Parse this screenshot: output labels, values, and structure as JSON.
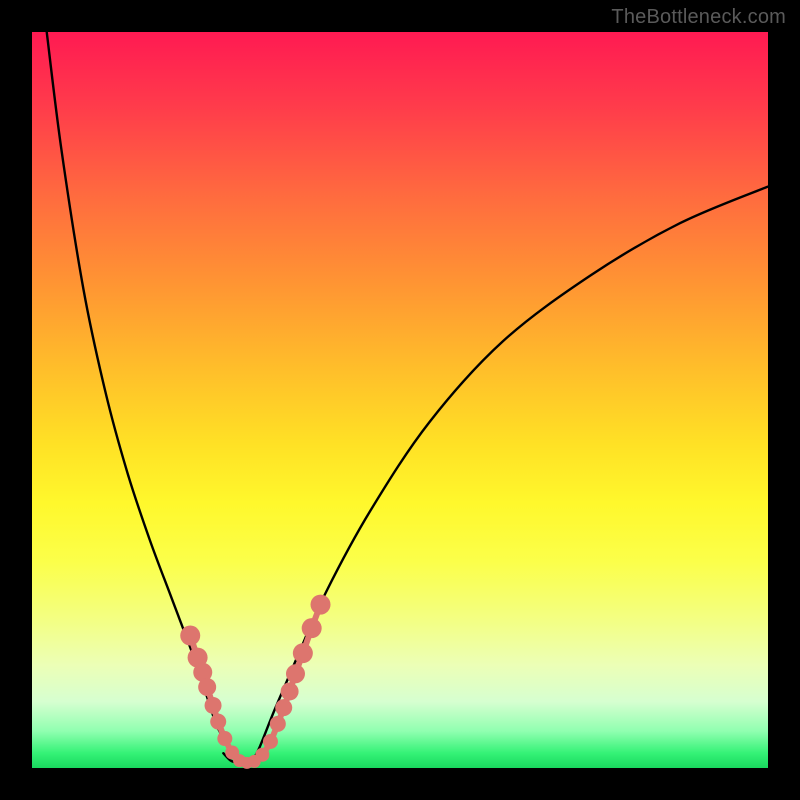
{
  "attribution": "TheBottleneck.com",
  "colors": {
    "bead": "#dd756e",
    "curve": "#000000",
    "background_frame": "#000000"
  },
  "chart_data": {
    "type": "line",
    "title": "",
    "xlabel": "",
    "ylabel": "",
    "xlim": [
      0,
      100
    ],
    "ylim": [
      0,
      100
    ],
    "grid": false,
    "legend": false,
    "annotations": [
      "TheBottleneck.com"
    ],
    "series": [
      {
        "name": "left-curve",
        "x": [
          2,
          4,
          7,
          10,
          13,
          16,
          19,
          22,
          24,
          25,
          26,
          27,
          28
        ],
        "y": [
          100,
          84,
          65,
          51,
          40,
          31,
          23,
          15,
          9,
          6,
          4,
          2,
          1
        ]
      },
      {
        "name": "right-curve",
        "x": [
          30,
          31,
          33,
          36,
          40,
          46,
          54,
          64,
          76,
          88,
          100
        ],
        "y": [
          1,
          3,
          8,
          15,
          24,
          35,
          47,
          58,
          67,
          74,
          79
        ]
      },
      {
        "name": "valley-floor",
        "x": [
          26,
          27,
          28,
          29,
          30,
          31,
          32
        ],
        "y": [
          2,
          1,
          0.7,
          0.6,
          0.7,
          1,
          2
        ]
      }
    ],
    "markers": {
      "name": "beads",
      "note": "salmon dotted overlay near valley on both branches",
      "points": [
        {
          "x": 21.5,
          "y": 18
        },
        {
          "x": 22.5,
          "y": 15
        },
        {
          "x": 23.2,
          "y": 13
        },
        {
          "x": 23.8,
          "y": 11
        },
        {
          "x": 24.6,
          "y": 8.5
        },
        {
          "x": 25.3,
          "y": 6.3
        },
        {
          "x": 26.2,
          "y": 4
        },
        {
          "x": 27.2,
          "y": 2.1
        },
        {
          "x": 28.2,
          "y": 1
        },
        {
          "x": 29.2,
          "y": 0.7
        },
        {
          "x": 30.2,
          "y": 0.9
        },
        {
          "x": 31.3,
          "y": 1.8
        },
        {
          "x": 32.4,
          "y": 3.6
        },
        {
          "x": 33.4,
          "y": 6
        },
        {
          "x": 34.2,
          "y": 8.2
        },
        {
          "x": 35.0,
          "y": 10.4
        },
        {
          "x": 35.8,
          "y": 12.8
        },
        {
          "x": 36.8,
          "y": 15.6
        },
        {
          "x": 38.0,
          "y": 19
        },
        {
          "x": 39.2,
          "y": 22.2
        }
      ]
    }
  }
}
